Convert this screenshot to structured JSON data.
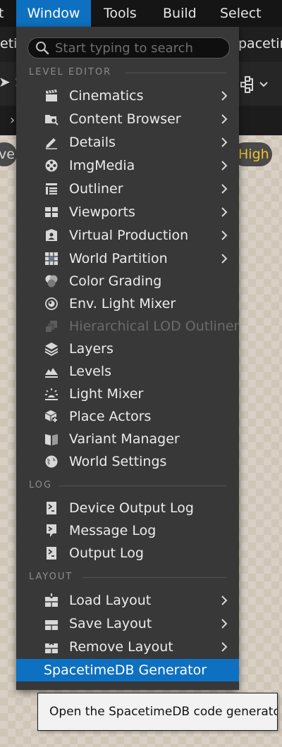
{
  "menubar": {
    "partial_left": "t",
    "items": [
      "Window",
      "Tools",
      "Build",
      "Select"
    ],
    "active_item": "Window"
  },
  "tabbar": {
    "left_text": "etir",
    "right_text": "pacetim"
  },
  "toolbar": {
    "left_text": "S"
  },
  "viewport": {
    "left_pill": "ve",
    "right_pill": "High",
    "right_pill_color": "#f2c230"
  },
  "search": {
    "placeholder": "Start typing to search",
    "value": ""
  },
  "sections": {
    "level_editor": "LEVEL EDITOR",
    "log": "LOG",
    "layout": "LAYOUT"
  },
  "level_editor_items": [
    {
      "label": "Cinematics",
      "icon": "clapperboard-icon",
      "submenu": true,
      "enabled": true
    },
    {
      "label": "Content Browser",
      "icon": "folder-search-icon",
      "submenu": true,
      "enabled": true
    },
    {
      "label": "Details",
      "icon": "pencil-icon",
      "submenu": true,
      "enabled": true
    },
    {
      "label": "ImgMedia",
      "icon": "film-reel-icon",
      "submenu": true,
      "enabled": true
    },
    {
      "label": "Outliner",
      "icon": "outliner-list-icon",
      "submenu": true,
      "enabled": true
    },
    {
      "label": "Viewports",
      "icon": "viewports-grid-icon",
      "submenu": true,
      "enabled": true
    },
    {
      "label": "Virtual Production",
      "icon": "virtual-production-icon",
      "submenu": true,
      "enabled": true
    },
    {
      "label": "World Partition",
      "icon": "world-partition-icon",
      "submenu": true,
      "enabled": true
    },
    {
      "label": "Color Grading",
      "icon": "color-grading-icon",
      "submenu": false,
      "enabled": true
    },
    {
      "label": "Env. Light Mixer",
      "icon": "env-light-mixer-icon",
      "submenu": false,
      "enabled": true
    },
    {
      "label": "Hierarchical LOD Outliner",
      "icon": "hlod-icon",
      "submenu": false,
      "enabled": false
    },
    {
      "label": "Layers",
      "icon": "layers-icon",
      "submenu": false,
      "enabled": true
    },
    {
      "label": "Levels",
      "icon": "levels-icon",
      "submenu": false,
      "enabled": true
    },
    {
      "label": "Light Mixer",
      "icon": "light-bulb-icon",
      "submenu": false,
      "enabled": true
    },
    {
      "label": "Place Actors",
      "icon": "place-actors-icon",
      "submenu": false,
      "enabled": true
    },
    {
      "label": "Variant Manager",
      "icon": "variant-manager-icon",
      "submenu": false,
      "enabled": true
    },
    {
      "label": "World Settings",
      "icon": "globe-icon",
      "submenu": false,
      "enabled": true
    }
  ],
  "log_items": [
    {
      "label": "Device Output Log",
      "icon": "terminal-icon"
    },
    {
      "label": "Message Log",
      "icon": "message-log-icon"
    },
    {
      "label": "Output Log",
      "icon": "terminal-icon"
    }
  ],
  "layout_items": [
    {
      "label": "Load Layout",
      "icon": "load-layout-icon",
      "submenu": true
    },
    {
      "label": "Save Layout",
      "icon": "save-layout-icon",
      "submenu": true
    },
    {
      "label": "Remove Layout",
      "icon": "remove-layout-icon",
      "submenu": true
    }
  ],
  "highlighted_item": {
    "label": "SpacetimeDB Generator",
    "highlight_color": "#0e70c0"
  },
  "tooltip": {
    "text": "Open the SpacetimeDB code generator."
  }
}
